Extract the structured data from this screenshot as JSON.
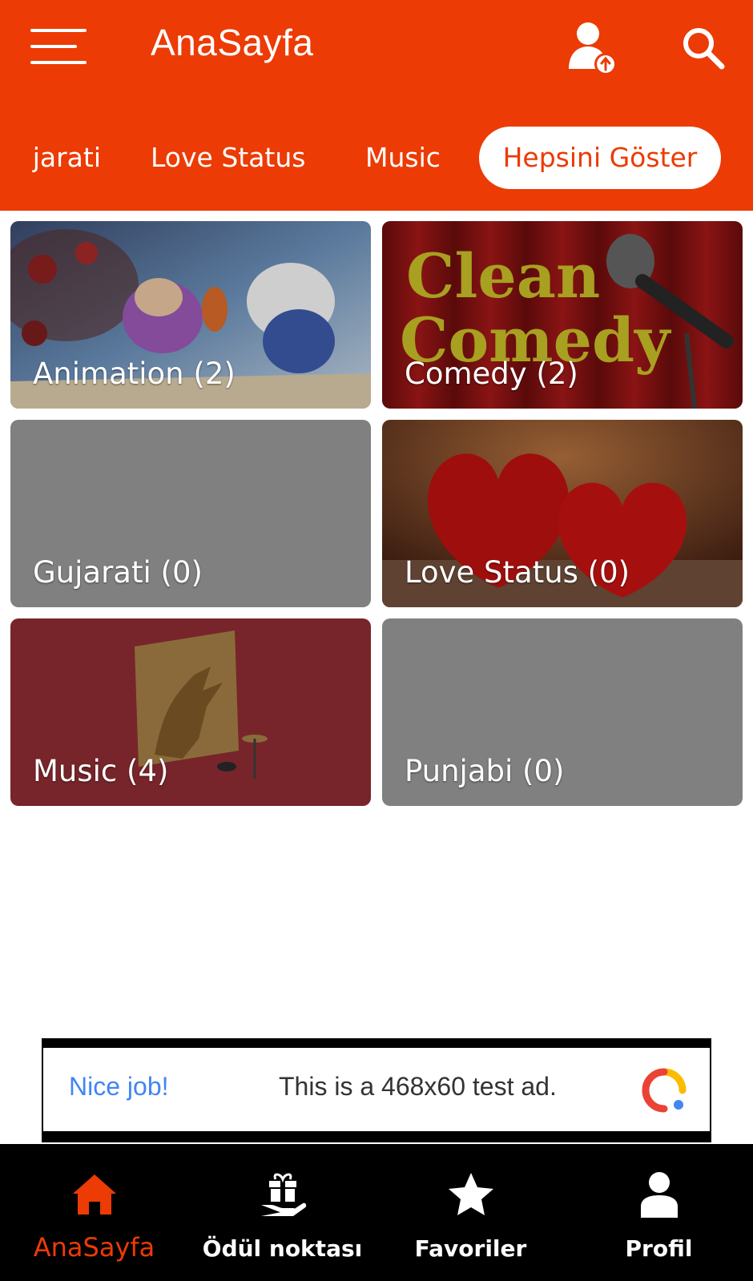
{
  "header": {
    "title": "AnaSayfa",
    "color": "#ec3b04",
    "icons": [
      "menu-icon",
      "user-upload-icon",
      "search-icon"
    ]
  },
  "chips": {
    "items": [
      {
        "label": "Gujarati"
      },
      {
        "label": "Love Status"
      },
      {
        "label": "Music"
      }
    ],
    "show_all": "Hepsini Göster"
  },
  "categories": [
    {
      "label": "Animation (2)"
    },
    {
      "label": "Comedy (2)"
    },
    {
      "label": "Gujarati (0)"
    },
    {
      "label": "Love Status (0)"
    },
    {
      "label": "Music (4)"
    },
    {
      "label": "Punjabi (0)"
    }
  ],
  "comedy_image": {
    "line1": "Clean",
    "line2": "Comedy"
  },
  "ad": {
    "nice": "Nice job!",
    "text": "This is a 468x60 test ad."
  },
  "bottom_nav": {
    "items": [
      {
        "label": "AnaSayfa",
        "icon": "home-icon",
        "active": true
      },
      {
        "label": "Ödül noktası",
        "icon": "gift-icon",
        "active": false
      },
      {
        "label": "Favoriler",
        "icon": "star-icon",
        "active": false
      },
      {
        "label": "Profil",
        "icon": "user-icon",
        "active": false
      }
    ]
  }
}
